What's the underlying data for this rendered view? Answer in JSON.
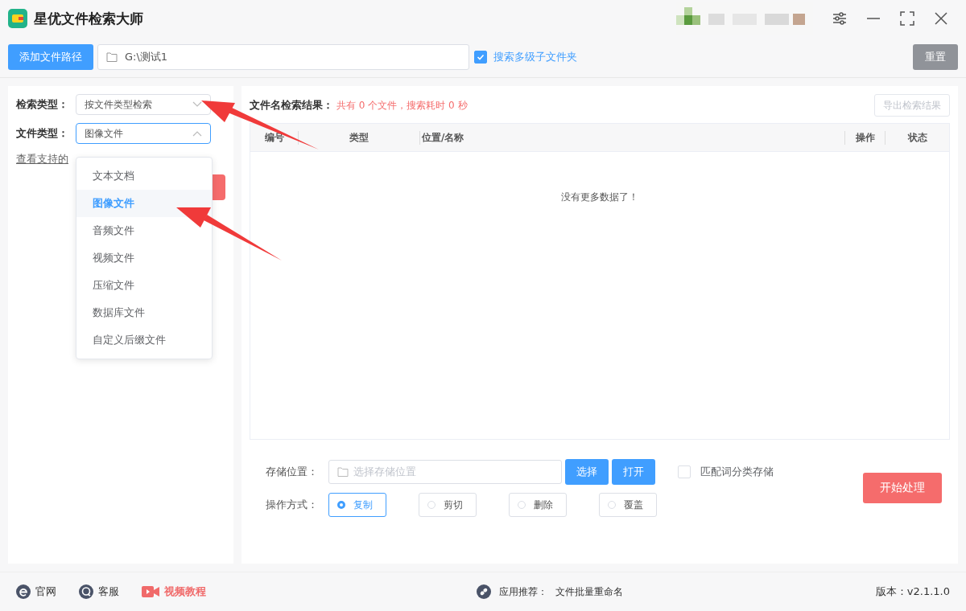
{
  "app": {
    "title": "星优文件检索大师"
  },
  "toolbar": {
    "add_button": "添加文件路径",
    "path": "G:\\测试1",
    "subfolders": {
      "label": "搜索多级子文件夹",
      "checked": true
    },
    "reset_button": "重置"
  },
  "filters": {
    "search_type": {
      "label": "检索类型：",
      "value": "按文件类型检索",
      "expanded": false
    },
    "file_type": {
      "label": "文件类型：",
      "value": "图像文件",
      "expanded": true
    },
    "link": "查看支持的",
    "options": [
      {
        "label": "文本文档",
        "selected": false
      },
      {
        "label": "图像文件",
        "selected": true
      },
      {
        "label": "音频文件",
        "selected": false
      },
      {
        "label": "视频文件",
        "selected": false
      },
      {
        "label": "压缩文件",
        "selected": false
      },
      {
        "label": "数据库文件",
        "selected": false
      },
      {
        "label": "自定义后缀文件",
        "selected": false
      }
    ]
  },
  "results": {
    "label": "文件名检索结果：",
    "summary": "共有 0 个文件，搜索耗时 0 秒",
    "export_button": "导出检索结果",
    "columns": [
      "编号",
      "类型",
      "位置/名称",
      "操作",
      "状态"
    ],
    "empty": "没有更多数据了！"
  },
  "storage": {
    "label": "存储位置：",
    "placeholder": "选择存储位置",
    "choose_button": "选择",
    "open_button": "打开",
    "match": {
      "label": "匹配词分类存储",
      "checked": false
    }
  },
  "operation": {
    "label": "操作方式：",
    "options": [
      {
        "label": "复制",
        "selected": true
      },
      {
        "label": "剪切",
        "selected": false
      },
      {
        "label": "删除",
        "selected": false
      },
      {
        "label": "覆盖",
        "selected": false
      }
    ]
  },
  "start_button": "开始处理",
  "footer": {
    "links": [
      {
        "label": "官网",
        "kind": "web"
      },
      {
        "label": "客服",
        "kind": "chat"
      },
      {
        "label": "视频教程",
        "kind": "video"
      }
    ],
    "recommend_label": "应用推荐：",
    "recommend": "文件批量重命名",
    "version": "版本：v2.1.1.0"
  }
}
